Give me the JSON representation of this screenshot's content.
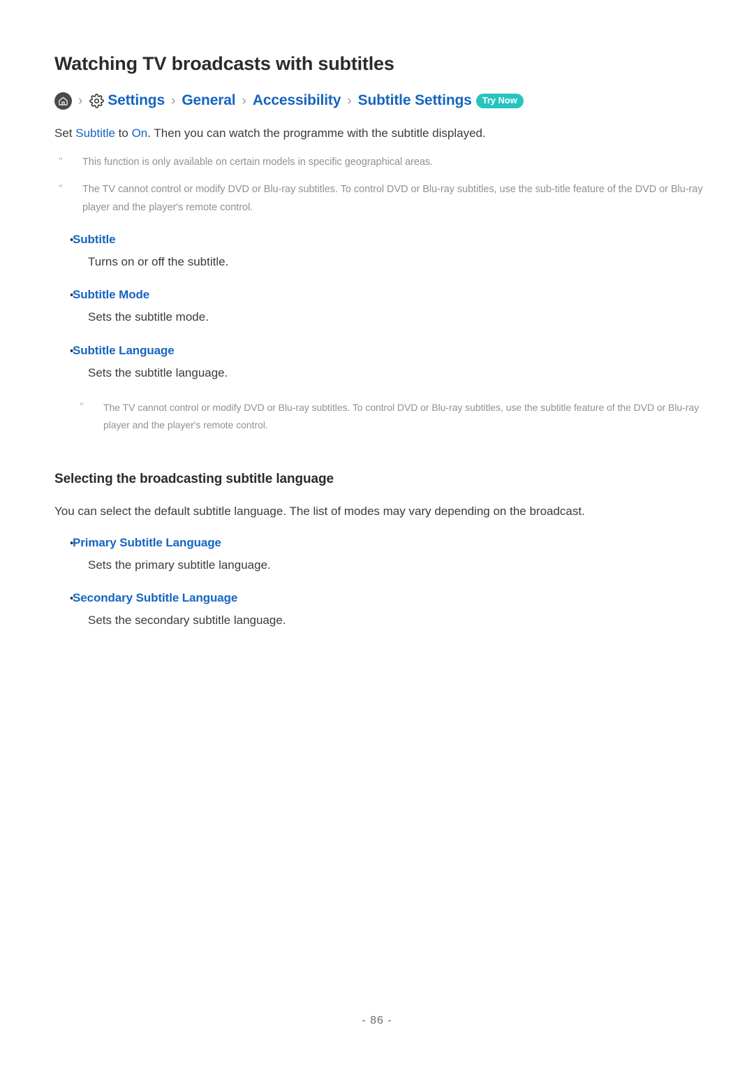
{
  "title": "Watching TV broadcasts with subtitles",
  "breadcrumb": {
    "home_icon": "home-icon",
    "gear_icon": "gear-icon",
    "separator": "›",
    "items": [
      {
        "label": "Settings"
      },
      {
        "label": "General"
      },
      {
        "label": "Accessibility"
      },
      {
        "label": "Subtitle Settings"
      }
    ],
    "badge": "Try Now",
    "badge_color": "#26c4bd"
  },
  "lead": {
    "part1": "Set ",
    "kw1": "Subtitle",
    "part2": " to ",
    "kw2": "On",
    "part3": ". Then you can watch the programme with the subtitle displayed."
  },
  "notes": [
    {
      "marker": "″",
      "text": "This function is only available on certain models in specific geographical areas."
    },
    {
      "marker": "″",
      "text": "The TV cannot control or modify DVD or Blu-ray subtitles. To control DVD or Blu-ray subtitles, use the sub-title feature of the DVD or Blu-ray player and the player's remote control."
    }
  ],
  "bullets": [
    {
      "bullet": "•",
      "label": "Subtitle",
      "desc": "Turns on or off the subtitle."
    },
    {
      "bullet": "•",
      "label": "Subtitle Mode",
      "desc": "Sets the subtitle mode."
    },
    {
      "bullet": "•",
      "label": "Subtitle Language",
      "desc": "Sets the subtitle language."
    }
  ],
  "nested_note": {
    "marker": "″",
    "text": "The TV cannot control or modify DVD or Blu-ray subtitles. To control DVD or Blu-ray subtitles, use the subtitle feature of the DVD or Blu-ray player and the player's remote control."
  },
  "section": {
    "title": "Selecting the broadcasting subtitle language",
    "intro": "You can select the default subtitle language. The list of modes may vary depending on the broadcast.",
    "bullets": [
      {
        "bullet": "•",
        "label": "Primary Subtitle Language",
        "desc": "Sets the primary subtitle language."
      },
      {
        "bullet": "•",
        "label": "Secondary Subtitle Language",
        "desc": "Sets the secondary subtitle language."
      }
    ]
  },
  "footer": {
    "page_number": "- 86 -"
  },
  "colors": {
    "link": "#1565c0",
    "body": "#3b3b3b",
    "note": "#8d9197",
    "badge": "#26c4bd"
  }
}
